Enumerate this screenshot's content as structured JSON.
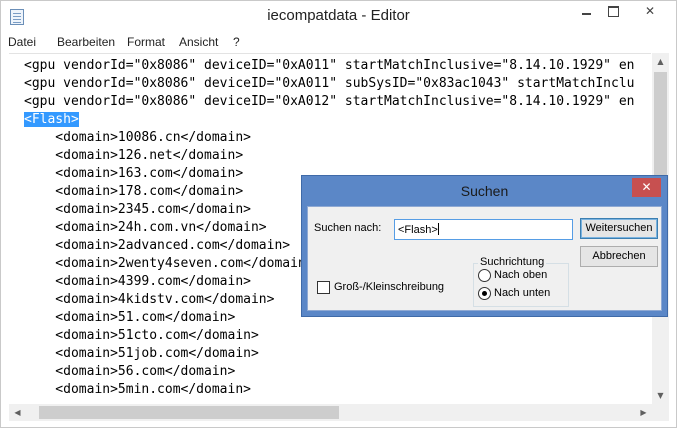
{
  "window": {
    "title": "iecompatdata - Editor",
    "close_glyph": "✕"
  },
  "menu": [
    "Datei",
    "Bearbeiten",
    "Format",
    "Ansicht",
    "?"
  ],
  "editor": {
    "lines": [
      "<gpu vendorId=\"0x8086\" deviceID=\"0xA011\" startMatchInclusive=\"8.14.10.1929\" en",
      "<gpu vendorId=\"0x8086\" deviceID=\"0xA011\" subSysID=\"0x83ac1043\" startMatchInclu",
      "<gpu vendorId=\"0x8086\" deviceID=\"0xA012\" startMatchInclusive=\"8.14.10.1929\" en",
      "<Flash>",
      "    <domain>10086.cn</domain>",
      "    <domain>126.net</domain>",
      "    <domain>163.com</domain>",
      "    <domain>178.com</domain>",
      "    <domain>2345.com</domain>",
      "    <domain>24h.com.vn</domain>",
      "    <domain>2advanced.com</domain>",
      "    <domain>2wenty4seven.com</domain>",
      "    <domain>4399.com</domain>",
      "    <domain>4kidstv.com</domain>",
      "    <domain>51.com</domain>",
      "    <domain>51cto.com</domain>",
      "    <domain>51job.com</domain>",
      "    <domain>56.com</domain>",
      "    <domain>5min.com</domain>"
    ],
    "selected_line_index": 3
  },
  "find_dialog": {
    "title": "Suchen",
    "close_glyph": "✕",
    "search_label": "Suchen nach:",
    "search_value": "<Flash>",
    "find_next_label": "Weitersuchen",
    "cancel_label": "Abbrechen",
    "direction_label": "Suchrichtung",
    "direction_up_label": "Nach oben",
    "direction_down_label": "Nach unten",
    "direction_selected": "down",
    "match_case_label": "Groß-/Kleinschreibung",
    "match_case_checked": false
  },
  "scrollbars": {
    "up": "▲",
    "down": "▼",
    "left": "◀",
    "right": "▶"
  },
  "colors": {
    "selection": "#3399ff",
    "dialog_frame": "#5b87c7",
    "close_button": "#c75050"
  }
}
